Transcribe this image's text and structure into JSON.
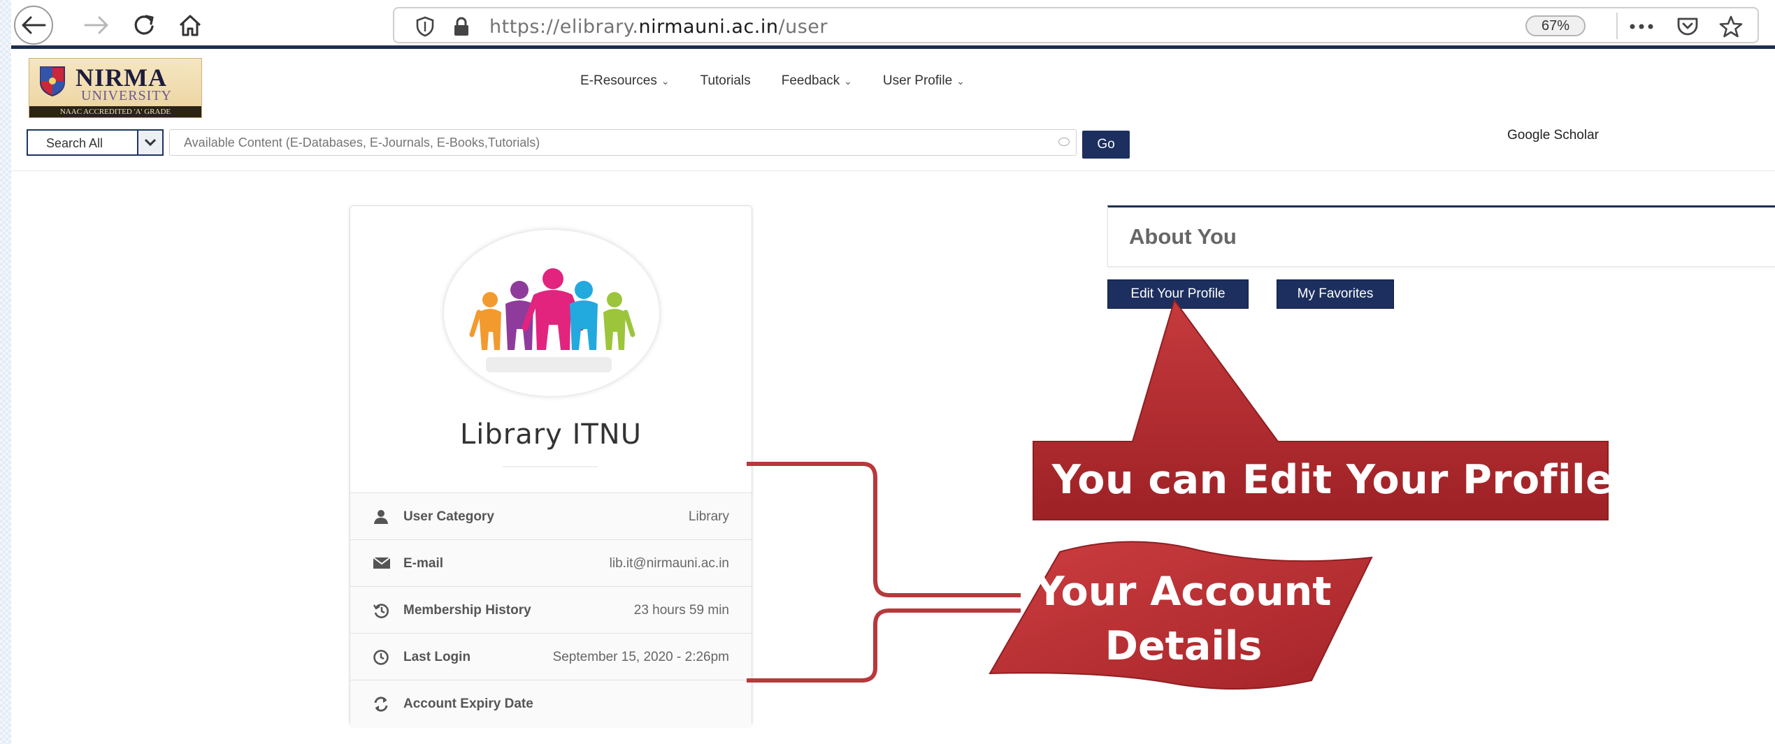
{
  "browser": {
    "url_prefix": "https://elibrary.",
    "url_host": "nirmauni.ac.in",
    "url_path": "/user",
    "zoom": "67%"
  },
  "site": {
    "logo_name": "NIRMA",
    "logo_sub": "UNIVERSITY",
    "logo_strip": "NAAC ACCREDITED 'A' GRADE",
    "nav": [
      {
        "label": "E-Resources",
        "has_dropdown": true
      },
      {
        "label": "Tutorials",
        "has_dropdown": false
      },
      {
        "label": "Feedback",
        "has_dropdown": true
      },
      {
        "label": "User Profile",
        "has_dropdown": true
      }
    ],
    "search": {
      "scope": "Search All",
      "placeholder": "Available Content (E-Databases, E-Journals, E-Books,Tutorials)",
      "go_label": "Go"
    },
    "scholar_link": "Google Scholar"
  },
  "profile": {
    "name": "Library ITNU",
    "details": [
      {
        "icon": "user-icon",
        "label": "User Category",
        "value": "Library"
      },
      {
        "icon": "envelope-icon",
        "label": "E-mail",
        "value": "lib.it@nirmauni.ac.in"
      },
      {
        "icon": "history-icon",
        "label": "Membership History",
        "value": "23 hours 59 min"
      },
      {
        "icon": "clock-icon",
        "label": "Last Login",
        "value": "September 15, 2020 - 2:26pm"
      },
      {
        "icon": "refresh-icon",
        "label": "Account Expiry Date",
        "value": ""
      }
    ]
  },
  "about": {
    "title": "About You",
    "edit_button": "Edit Your Profile",
    "favorites_button": "My Favorites"
  },
  "callouts": {
    "edit_profile": "You can Edit Your Profile",
    "account_line1": "Your Account",
    "account_line2": "Details"
  },
  "colors": {
    "navy": "#1c2f5f",
    "callout_red": "#b5282c"
  }
}
